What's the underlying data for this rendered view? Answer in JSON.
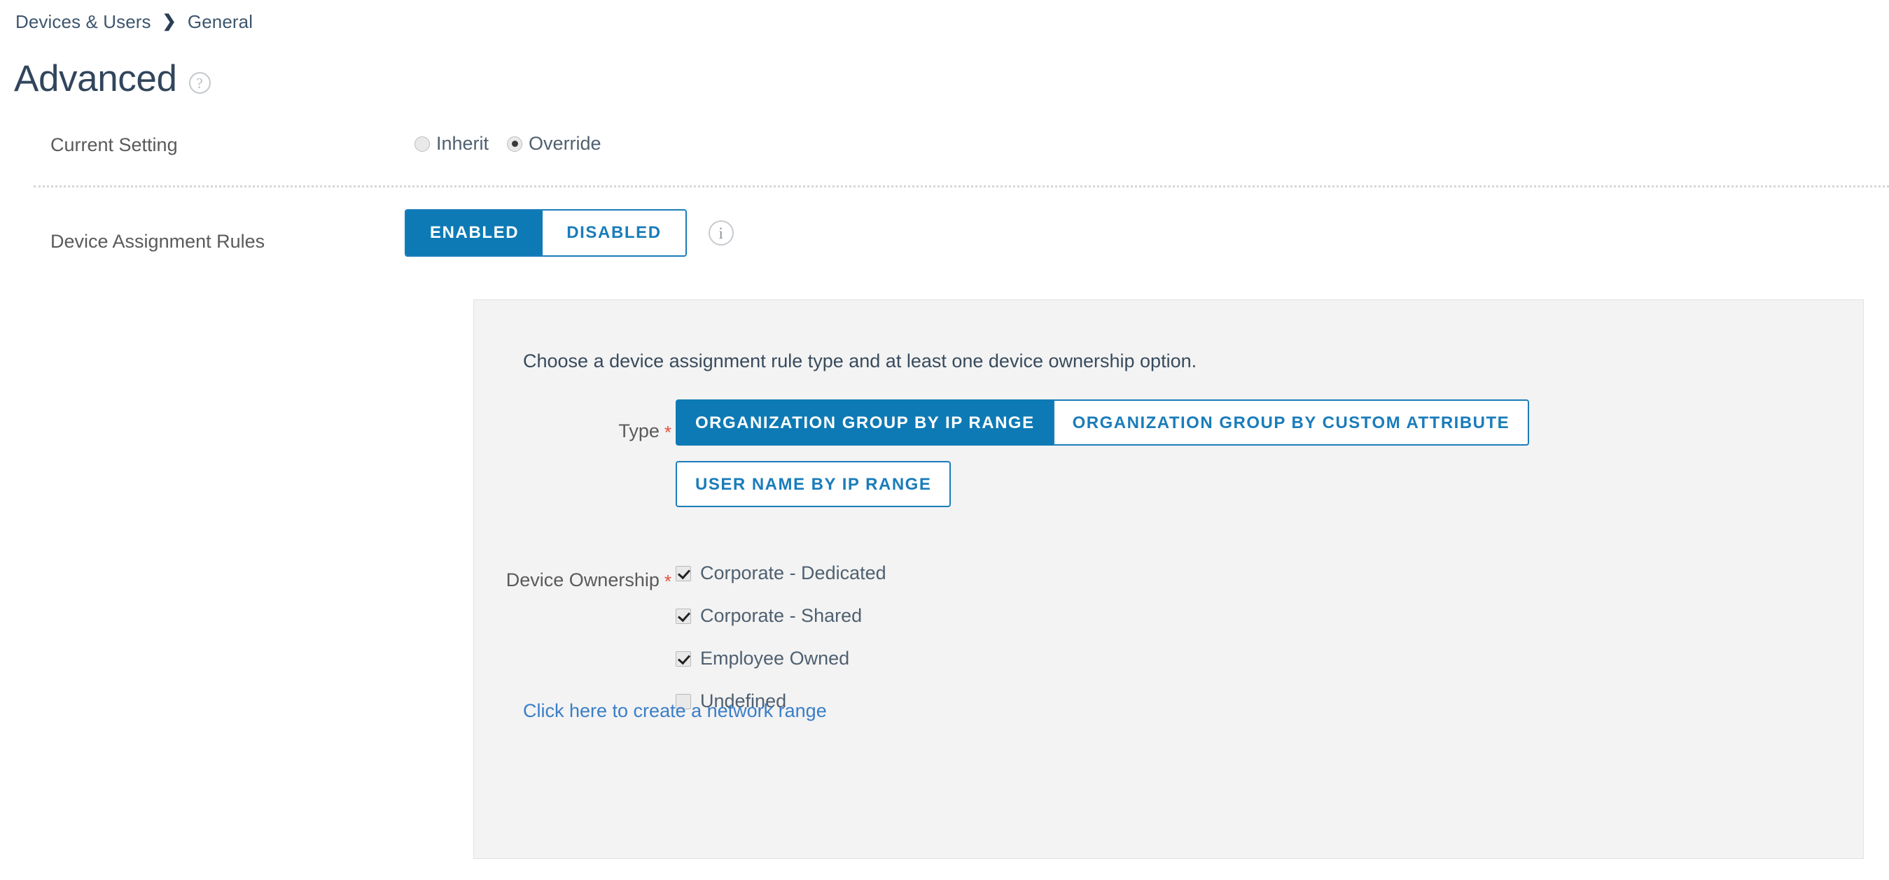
{
  "breadcrumb": {
    "items": [
      {
        "label": "Devices & Users"
      },
      {
        "label": "General"
      }
    ],
    "separator": "❯"
  },
  "page": {
    "title": "Advanced",
    "help_icon_glyph": "?",
    "help_icon_name": "help-circle-icon"
  },
  "current_setting": {
    "label": "Current Setting",
    "options": [
      {
        "label": "Inherit",
        "selected": false
      },
      {
        "label": "Override",
        "selected": true
      }
    ],
    "selected_value": "Override"
  },
  "device_assignment_rules": {
    "label": "Device Assignment Rules",
    "toggle": {
      "enabled_label": "ENABLED",
      "disabled_label": "DISABLED",
      "selected": "ENABLED"
    },
    "info_icon_glyph": "i",
    "info_icon_name": "info-circle-icon"
  },
  "panel": {
    "intro": "Choose a device assignment rule type and at least one device ownership option.",
    "type": {
      "label": "Type",
      "required": true,
      "required_marker": "*",
      "options": [
        {
          "label": "ORGANIZATION GROUP BY IP RANGE",
          "selected": true
        },
        {
          "label": "ORGANIZATION GROUP BY CUSTOM ATTRIBUTE",
          "selected": false
        },
        {
          "label": "USER NAME BY IP RANGE",
          "selected": false
        }
      ],
      "selected_value": "ORGANIZATION GROUP BY IP RANGE"
    },
    "device_ownership": {
      "label": "Device Ownership",
      "required": true,
      "required_marker": "*",
      "options": [
        {
          "label": "Corporate - Dedicated",
          "checked": true
        },
        {
          "label": "Corporate - Shared",
          "checked": true
        },
        {
          "label": "Employee Owned",
          "checked": true
        },
        {
          "label": "Undefined",
          "checked": false
        }
      ]
    },
    "network_range_link": "Click here to create a network range"
  },
  "colors": {
    "accent_blue": "#0d7ab5",
    "link_blue": "#3a7ec8",
    "border_blue": "#1a7cba",
    "panel_bg": "#f3f3f3",
    "required_red": "#e8503a",
    "heading": "#31465c"
  }
}
